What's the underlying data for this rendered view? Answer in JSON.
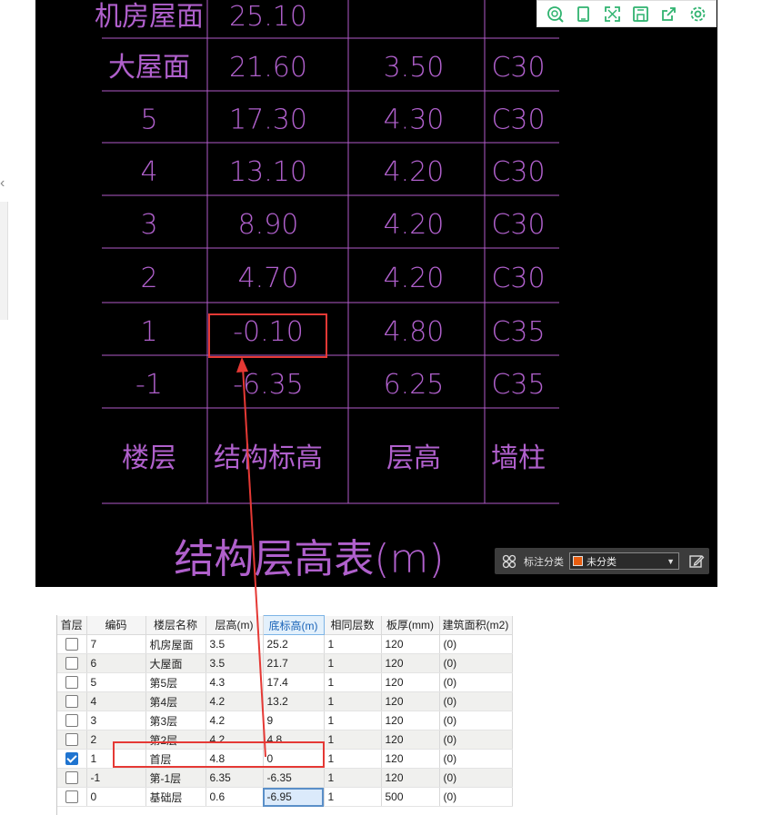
{
  "cad": {
    "rows": [
      {
        "floor": "机房屋面",
        "elev": "25.10",
        "height": "",
        "grade": ""
      },
      {
        "floor": "大屋面",
        "elev": "21.60",
        "height": "3.50",
        "grade": "C30"
      },
      {
        "floor": "5",
        "elev": "17.30",
        "height": "4.30",
        "grade": "C30"
      },
      {
        "floor": "4",
        "elev": "13.10",
        "height": "4.20",
        "grade": "C30"
      },
      {
        "floor": "3",
        "elev": "8.90",
        "height": "4.20",
        "grade": "C30"
      },
      {
        "floor": "2",
        "elev": "4.70",
        "height": "4.20",
        "grade": "C30"
      },
      {
        "floor": "1",
        "elev": "-0.10",
        "height": "4.80",
        "grade": "C35"
      },
      {
        "floor": "-1",
        "elev": "-6.35",
        "height": "6.25",
        "grade": "C35"
      }
    ],
    "headers": {
      "floor": "楼层",
      "elev": "结构标高",
      "height": "层高",
      "grade": "墙柱"
    },
    "title": "结构层高表(m)",
    "line_color": "#b05ac8",
    "text_color": "#b060cc"
  },
  "toolbar": {
    "icons": [
      "zoom-icon",
      "copy-icon",
      "fullscreen-icon",
      "save-icon",
      "export-icon",
      "settings-icon"
    ],
    "icon_color": "#2fb36f"
  },
  "annotation": {
    "label": "标注分类",
    "selected": "未分类",
    "swatch_color": "#e85d10"
  },
  "grid": {
    "columns": [
      "首层",
      "编码",
      "楼层名称",
      "层高(m)",
      "底标高(m)",
      "相同层数",
      "板厚(mm)",
      "建筑面积(m2)"
    ],
    "active_column": 4,
    "rows": [
      {
        "checked": false,
        "code": "7",
        "name": "机房屋面",
        "height": "3.5",
        "base": "25.2",
        "same": "1",
        "thick": "120",
        "area": "(0)"
      },
      {
        "checked": false,
        "code": "6",
        "name": "大屋面",
        "height": "3.5",
        "base": "21.7",
        "same": "1",
        "thick": "120",
        "area": "(0)"
      },
      {
        "checked": false,
        "code": "5",
        "name": "第5层",
        "height": "4.3",
        "base": "17.4",
        "same": "1",
        "thick": "120",
        "area": "(0)"
      },
      {
        "checked": false,
        "code": "4",
        "name": "第4层",
        "height": "4.2",
        "base": "13.2",
        "same": "1",
        "thick": "120",
        "area": "(0)"
      },
      {
        "checked": false,
        "code": "3",
        "name": "第3层",
        "height": "4.2",
        "base": "9",
        "same": "1",
        "thick": "120",
        "area": "(0)"
      },
      {
        "checked": false,
        "code": "2",
        "name": "第2层",
        "height": "4.2",
        "base": "4.8",
        "same": "1",
        "thick": "120",
        "area": "(0)"
      },
      {
        "checked": true,
        "code": "1",
        "name": "首层",
        "height": "4.8",
        "base": "0",
        "same": "1",
        "thick": "120",
        "area": "(0)"
      },
      {
        "checked": false,
        "code": "-1",
        "name": "第-1层",
        "height": "6.35",
        "base": "-6.35",
        "same": "1",
        "thick": "120",
        "area": "(0)"
      },
      {
        "checked": false,
        "code": "0",
        "name": "基础层",
        "height": "0.6",
        "base": "-6.95",
        "same": "1",
        "thick": "500",
        "area": "(0)"
      }
    ],
    "selected_row": 8
  },
  "highlight_color": "#e53935"
}
